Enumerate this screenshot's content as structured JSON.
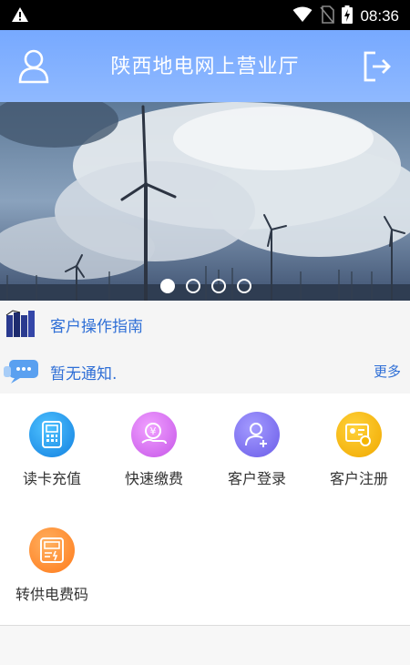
{
  "status_bar": {
    "time": "08:36"
  },
  "header": {
    "title": "陕西地电网上营业厅"
  },
  "banner": {
    "slide_count": 4,
    "active_index": 0
  },
  "guide": {
    "label": "客户操作指南"
  },
  "notice": {
    "text": "暂无通知.",
    "more_label": "更多"
  },
  "menu": {
    "items": [
      {
        "label": "读卡充值",
        "icon": "card-reader-icon",
        "color": "#1e9bf0"
      },
      {
        "label": "快速缴费",
        "icon": "yuan-payment-icon",
        "color": "#d86df0"
      },
      {
        "label": "客户登录",
        "icon": "user-add-icon",
        "color": "#7a6df2"
      },
      {
        "label": "客户注册",
        "icon": "id-card-link-icon",
        "color": "#f5b500"
      },
      {
        "label": "转供电费码",
        "icon": "meter-icon",
        "color": "#ff8a2b"
      }
    ]
  },
  "colors": {
    "header": "#7fb0ff",
    "link": "#2f6fd6"
  }
}
